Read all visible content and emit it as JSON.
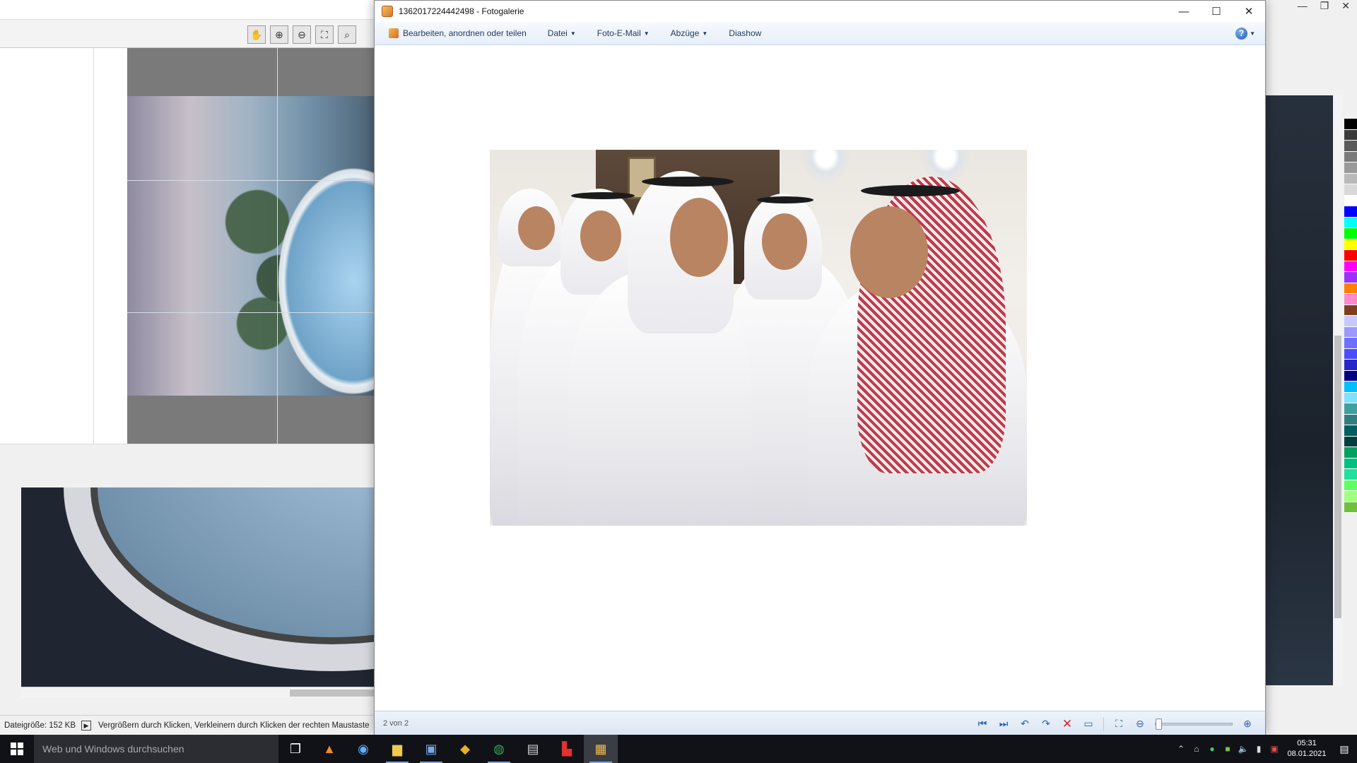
{
  "background_app": {
    "status_size": "Dateigröße: 152 KB",
    "status_hint": "Vergrößern durch Klicken, Verkleinern durch Klicken der rechten Maustaste"
  },
  "gallery": {
    "title": "1362017224442498 - Fotogalerie",
    "menu": {
      "organize": "Bearbeiten, anordnen oder teilen",
      "file": "Datei",
      "email": "Foto-E-Mail",
      "prints": "Abzüge",
      "slideshow": "Diashow"
    },
    "counter": "2 von 2"
  },
  "taskbar": {
    "search_placeholder": "Web und Windows durchsuchen",
    "time": "05:31",
    "date": "08.01.2021"
  },
  "palette_colors": [
    "#000000",
    "#3a3a3a",
    "#5a5a5a",
    "#7a7a7a",
    "#9a9a9a",
    "#b9b9b9",
    "#d8d8d8",
    "#ffffff",
    "#0000ff",
    "#00ffff",
    "#00ff00",
    "#ffff00",
    "#ff0000",
    "#ff00ff",
    "#9b30ff",
    "#ff7f00",
    "#ff88cc",
    "#7f3f1f",
    "#c8c8ff",
    "#9999ff",
    "#6f6fff",
    "#4c4cff",
    "#2626c8",
    "#00007f",
    "#00bfff",
    "#80e0ff",
    "#40a0a0",
    "#2f7f7f",
    "#006060",
    "#004040",
    "#00a060",
    "#00c080",
    "#20e0a0",
    "#60ff60",
    "#a0ff80",
    "#70c040"
  ]
}
